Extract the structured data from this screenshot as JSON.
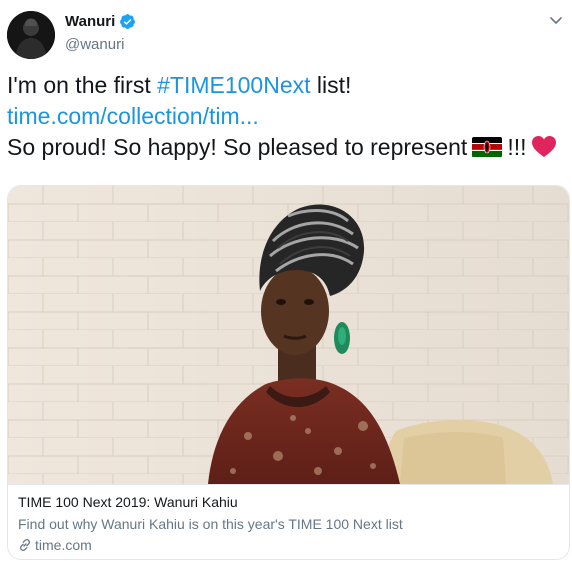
{
  "user": {
    "display_name": "Wanuri",
    "handle": "@wanuri"
  },
  "tweet": {
    "text_1": "I'm on the first ",
    "hashtag": "#TIME100Next",
    "text_1b": " list!",
    "link_text": "time.com/collection/tim...",
    "text_2": "So proud! So happy! So pleased to represent",
    "text_2b": "!!!",
    "flag_icon": "kenya-flag-icon",
    "heart_icon": "red-heart-icon"
  },
  "card": {
    "title": "TIME 100 Next 2019: Wanuri Kahiu",
    "description": "Find out why Wanuri Kahiu is on this year's TIME 100 Next list",
    "domain": "time.com"
  },
  "colors": {
    "link": "#1b95e0",
    "verified": "#1da1f2",
    "secondary_text": "#657786"
  }
}
